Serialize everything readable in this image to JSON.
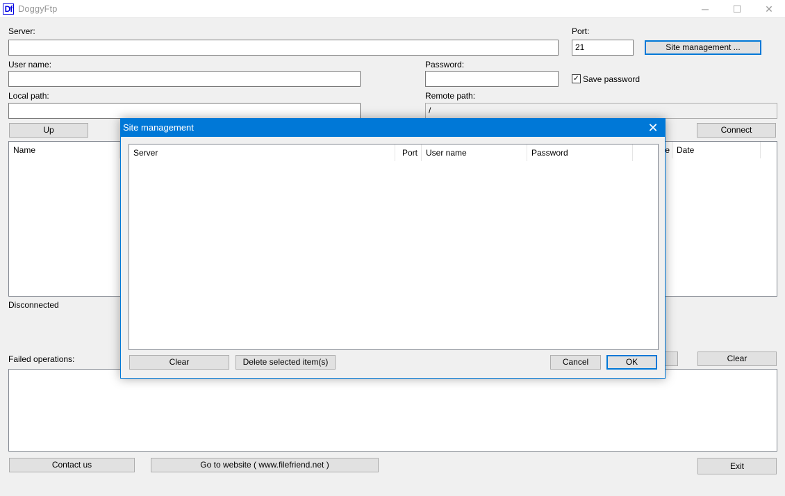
{
  "window": {
    "logo": "Df",
    "title": "DoggyFtp",
    "minimize": "─",
    "maximize": "☐",
    "close": "✕"
  },
  "server": {
    "label": "Server:",
    "value": ""
  },
  "port": {
    "label": "Port:",
    "value": "21"
  },
  "site_management_button": "Site management ...",
  "username": {
    "label": "User name:",
    "value": ""
  },
  "password": {
    "label": "Password:",
    "value": ""
  },
  "save_password": {
    "label": "Save password",
    "checked": true,
    "mark": "✓"
  },
  "local_path": {
    "label": "Local path:",
    "value": ""
  },
  "remote_path": {
    "label": "Remote path:",
    "value": "/"
  },
  "up_button": "Up",
  "connect_button": "Connect",
  "local_list": {
    "columns": [
      "Name"
    ]
  },
  "remote_list": {
    "columns": [
      "e",
      "Date"
    ]
  },
  "status": "Disconnected",
  "failed_operations": {
    "label": "Failed operations:",
    "clear_button": "Clear"
  },
  "footer": {
    "contact": "Contact us",
    "website": "Go to website ( www.filefriend.net )",
    "exit": "Exit"
  },
  "dialog": {
    "title": "Site management",
    "close": "✕",
    "columns": [
      "Server",
      "Port",
      "User name",
      "Password"
    ],
    "rows": [],
    "clear_button": "Clear",
    "delete_button": "Delete selected item(s)",
    "cancel_button": "Cancel",
    "ok_button": "OK"
  }
}
